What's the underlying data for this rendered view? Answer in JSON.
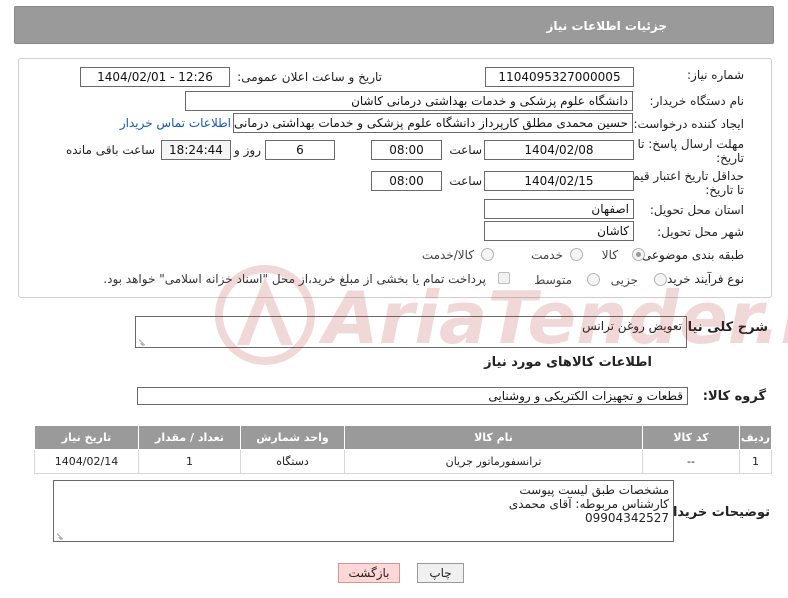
{
  "header": {
    "title": "جزئیات اطلاعات نیاز"
  },
  "form": {
    "need_number_label": "شماره نیاز:",
    "need_number": "1104095327000005",
    "announce_label": "تاریخ و ساعت اعلان عمومی:",
    "announce_value": "1404/02/01 - 12:26",
    "buyer_org_label": "نام دستگاه خریدار:",
    "buyer_org": "دانشگاه علوم پزشکی و خدمات بهداشتی درمانی کاشان",
    "creator_label": "ایجاد کننده درخواست:",
    "creator": "حسین محمدی مطلق کارپرداز دانشگاه علوم پزشکی و خدمات بهداشتی درمانی",
    "contact_link": "اطلاعات تماس خریدار",
    "deadline_label_1": "مهلت ارسال پاسخ: تا",
    "deadline_label_2": "تاریخ:",
    "deadline_date": "1404/02/08",
    "time_label": "ساعت",
    "deadline_time": "08:00",
    "days_value": "6",
    "days_label": "روز و",
    "remaining_time": "18:24:44",
    "remaining_label": "ساعت باقی مانده",
    "price_valid_label_1": "حداقل تاریخ اعتبار قیمت:",
    "price_valid_label_2": "تا تاریخ:",
    "price_valid_date": "1404/02/15",
    "price_valid_time": "08:00",
    "province_label": "استان محل تحویل:",
    "province": "اصفهان",
    "city_label": "شهر محل تحویل:",
    "city": "کاشان",
    "category_label": "طبقه بندی موضوعی:",
    "category_options": [
      "کالا",
      "خدمت",
      "کالا/خدمت"
    ],
    "process_label": "نوع فرآیند خرید :",
    "process_options": [
      "جزیی",
      "متوسط"
    ],
    "payment_note": "پرداخت تمام یا بخشی از مبلغ خرید،از محل \"اسناد خزانه اسلامی\" خواهد بود."
  },
  "description": {
    "label": "شرح کلی نیاز:",
    "value": "تعویض روغن ترانس"
  },
  "items_section": {
    "title": "اطلاعات کالاهای مورد نیاز",
    "group_label": "گروه کالا:",
    "group_value": "قطعات و تجهیزات الکتریکی و روشنایی",
    "columns": [
      "ردیف",
      "کد کالا",
      "نام کالا",
      "واحد شمارش",
      "تعداد / مقدار",
      "تاریخ نیاز"
    ],
    "rows": [
      [
        "1",
        "--",
        "ترانسفورماتور جریان",
        "دستگاه",
        "1",
        "1404/02/14"
      ]
    ]
  },
  "buyer_notes": {
    "label": "توضیحات خریدار:",
    "lines": [
      "مشخصات طبق لیست پیوست",
      "کارشناس مربوطه: آقای محمدی",
      "09904342527"
    ]
  },
  "buttons": {
    "print": "چاپ",
    "back": "بازگشت"
  },
  "watermark": {
    "text": "AriaTender.net"
  },
  "colors": {
    "header_bg": "#9a9a9a",
    "link": "#1a56b3",
    "back_button": "#ffd7d7"
  }
}
